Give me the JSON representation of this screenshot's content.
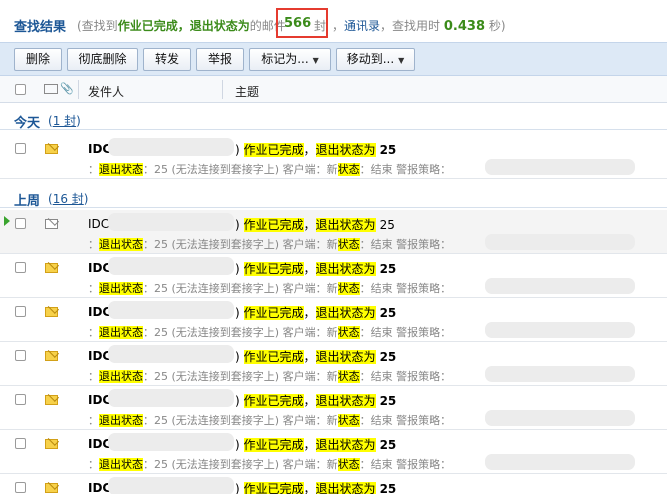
{
  "summary": {
    "title": "查找结果",
    "prefix": "(查找到",
    "kw1": "作业已完成，退出状态为",
    "mid": "的邮件",
    "count": "566",
    "unit": "封",
    "sep": "，",
    "link": "通讯录",
    "time_prefix": "，查找用时",
    "time": "0.438",
    "time_suffix": "秒)"
  },
  "toolbar": {
    "delete": "删除",
    "purge": "彻底删除",
    "forward": "转发",
    "report": "举报",
    "mark_as": "标记为...",
    "move_to": "移动到..."
  },
  "header": {
    "sender": "发件人",
    "subject": "主题"
  },
  "groups": {
    "today": {
      "label": "今天",
      "count": "1 封"
    },
    "last_week": {
      "label": "上周",
      "count": "16 封"
    }
  },
  "row": {
    "sender": "IDC",
    "subject_prefix": ")",
    "subject_kw1": "作业已完成",
    "subject_sep": "，",
    "subject_kw2": "退出状态为",
    "subject_num": "25",
    "preview_lead": "：",
    "preview_kw1": "退出状态",
    "preview_mid": "：25 (无法连接到套接字上) 客户端：新",
    "preview_kw2": "状态",
    "preview_tail": "：结束 警报策略："
  }
}
